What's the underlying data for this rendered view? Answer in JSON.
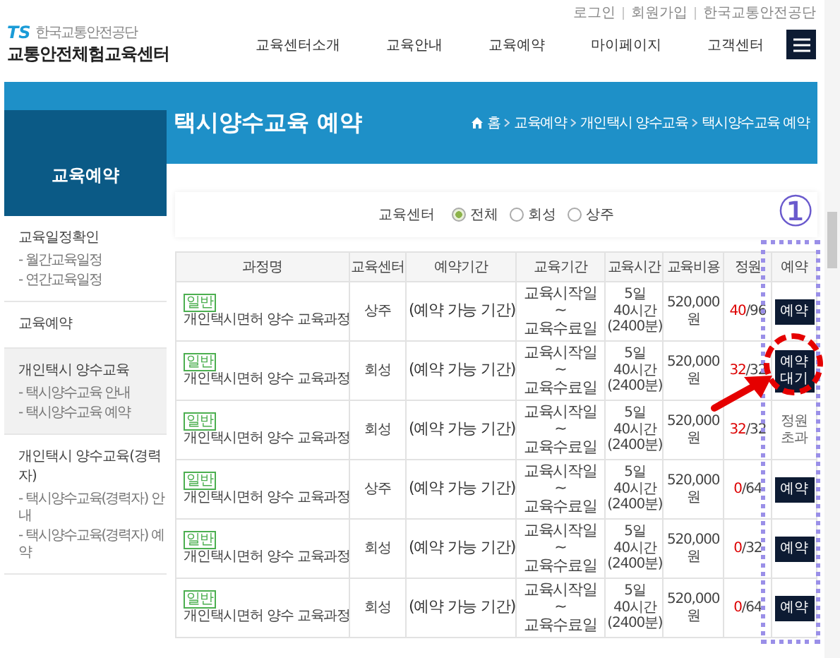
{
  "top_links": [
    "로그인",
    "회원가입",
    "한국교통안전공단"
  ],
  "logo": {
    "mark": "TS",
    "org": "한국교통안전공단",
    "name": "교통안전체험교육센터"
  },
  "nav": [
    "교육센터소개",
    "교육안내",
    "교육예약",
    "마이페이지",
    "고객센터"
  ],
  "banner": {
    "title": "택시양수교육 예약",
    "breadcrumb": [
      "홈",
      "교육예약",
      "개인택시 양수교육",
      "택시양수교육 예약"
    ]
  },
  "sidebar": {
    "title": "교육예약",
    "sections": [
      {
        "label": "교육일정확인",
        "selected": false,
        "children": [
          {
            "label": "- 월간교육일정"
          },
          {
            "label": "- 연간교육일정"
          }
        ]
      },
      {
        "label": "교육예약",
        "selected": false
      },
      {
        "label": "개인택시 양수교육",
        "selected": true,
        "children": [
          {
            "label": "- 택시양수교육 안내"
          },
          {
            "label": "- 택시양수교육 예약"
          }
        ]
      },
      {
        "label": "개인택시 양수교육(경력자)",
        "selected": false,
        "children": [
          {
            "label": "- 택시양수교육(경력자) 안내"
          },
          {
            "label": "- 택시양수교육(경력자) 예약"
          }
        ]
      }
    ]
  },
  "filter": {
    "label": "교육센터",
    "options": [
      {
        "label": "전체",
        "selected": true
      },
      {
        "label": "회성",
        "selected": false
      },
      {
        "label": "상주",
        "selected": false
      }
    ]
  },
  "table": {
    "columns": [
      "과정명",
      "교육센터",
      "예약기간",
      "교육기간",
      "교육시간",
      "교육비용",
      "정원",
      "예약"
    ],
    "rows": [
      {
        "tag": "일반",
        "course": "개인택시면허 양수 교육과정",
        "center": "상주",
        "period": "(예약 가능 기간)",
        "dates": [
          "교육시작일",
          "~",
          "교육수료일"
        ],
        "hours": [
          "5일",
          "40시간",
          "(2400분)"
        ],
        "fee": [
          "520,000",
          "원"
        ],
        "enrolled": "40",
        "capacity": "/96",
        "action": {
          "kind": "button",
          "lines": [
            "예약"
          ]
        }
      },
      {
        "tag": "일반",
        "course": "개인택시면허 양수 교육과정",
        "center": "회성",
        "period": "(예약 가능 기간)",
        "dates": [
          "교육시작일",
          "~",
          "교육수료일"
        ],
        "hours": [
          "5일",
          "40시간",
          "(2400분)"
        ],
        "fee": [
          "520,000",
          "원"
        ],
        "enrolled": "32",
        "capacity": "/32",
        "action": {
          "kind": "button",
          "lines": [
            "예약",
            "대기"
          ]
        }
      },
      {
        "tag": "일반",
        "course": "개인택시면허 양수 교육과정",
        "center": "회성",
        "period": "(예약 가능 기간)",
        "dates": [
          "교육시작일",
          "~",
          "교육수료일"
        ],
        "hours": [
          "5일",
          "40시간",
          "(2400분)"
        ],
        "fee": [
          "520,000",
          "원"
        ],
        "enrolled": "32",
        "capacity": "/32",
        "action": {
          "kind": "text",
          "lines": [
            "정원",
            "초과"
          ]
        }
      },
      {
        "tag": "일반",
        "course": "개인택시면허 양수 교육과정",
        "center": "상주",
        "period": "(예약 가능 기간)",
        "dates": [
          "교육시작일",
          "~",
          "교육수료일"
        ],
        "hours": [
          "5일",
          "40시간",
          "(2400분)"
        ],
        "fee": [
          "520,000",
          "원"
        ],
        "enrolled": "0",
        "capacity": "/64",
        "action": {
          "kind": "button",
          "lines": [
            "예약"
          ]
        }
      },
      {
        "tag": "일반",
        "course": "개인택시면허 양수 교육과정",
        "center": "회성",
        "period": "(예약 가능 기간)",
        "dates": [
          "교육시작일",
          "~",
          "교육수료일"
        ],
        "hours": [
          "5일",
          "40시간",
          "(2400분)"
        ],
        "fee": [
          "520,000",
          "원"
        ],
        "enrolled": "0",
        "capacity": "/32",
        "action": {
          "kind": "button",
          "lines": [
            "예약"
          ]
        }
      },
      {
        "tag": "일반",
        "course": "개인택시면허 양수 교육과정",
        "center": "회성",
        "period": "(예약 가능 기간)",
        "dates": [
          "교육시작일",
          "~",
          "교육수료일"
        ],
        "hours": [
          "5일",
          "40시간",
          "(2400분)"
        ],
        "fee": [
          "520,000",
          "원"
        ],
        "enrolled": "0",
        "capacity": "/64",
        "action": {
          "kind": "button",
          "lines": [
            "예약"
          ]
        }
      }
    ]
  },
  "annotation": {
    "marker": "①"
  }
}
